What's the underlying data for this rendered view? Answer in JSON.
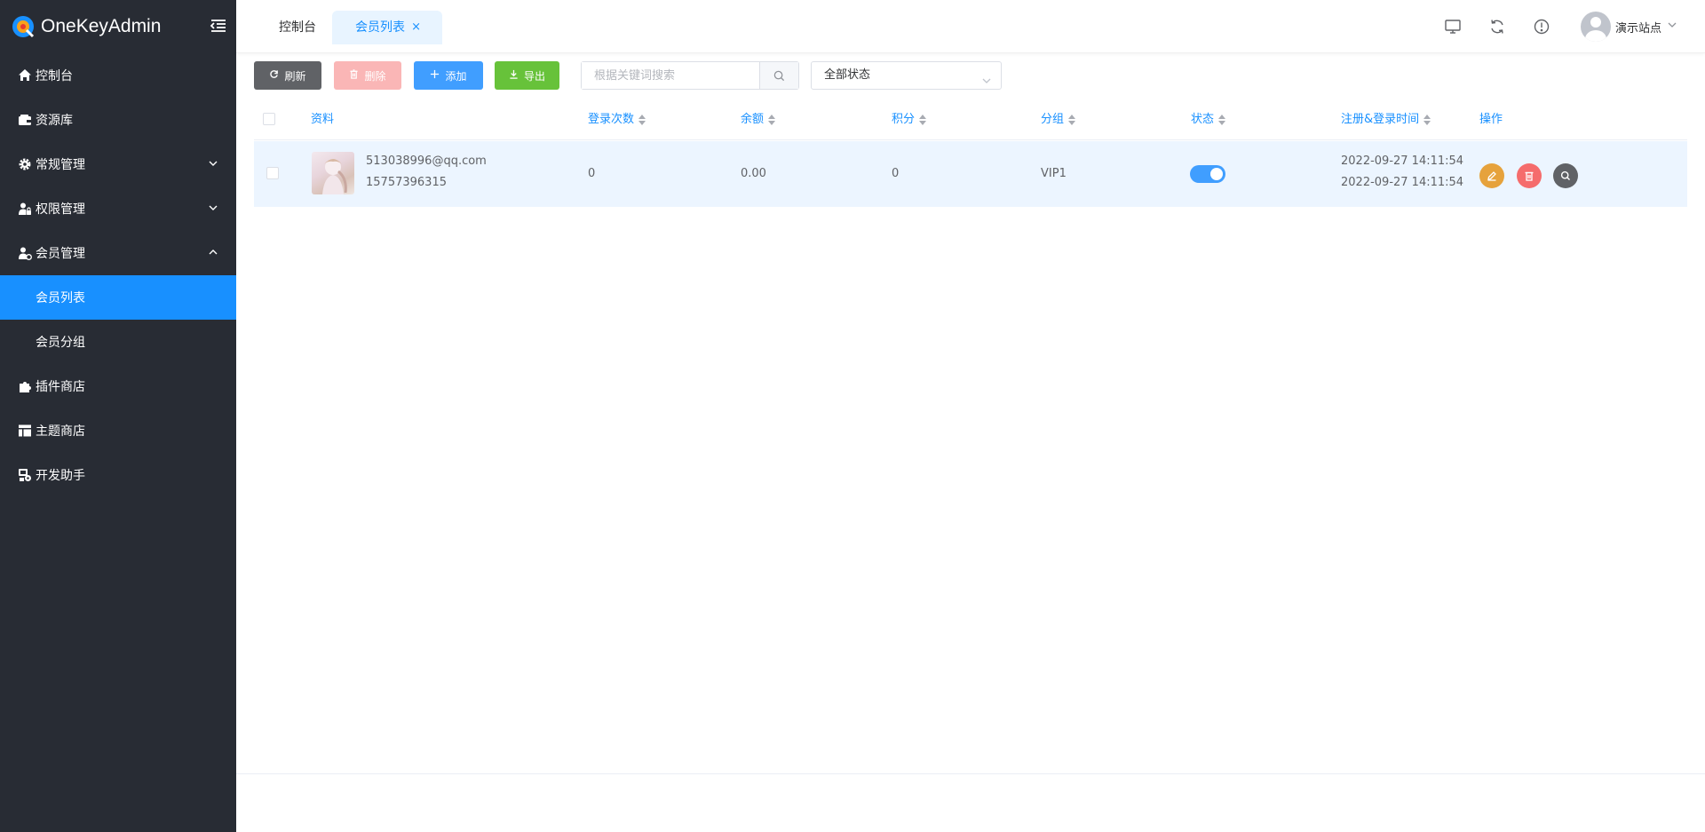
{
  "app": {
    "title": "OneKeyAdmin",
    "accent_color": "#1890ff",
    "sidebar_bg": "#282c34"
  },
  "sidebar": {
    "items": [
      {
        "label": "控制台",
        "icon": "home-icon"
      },
      {
        "label": "资源库",
        "icon": "wallet-icon"
      },
      {
        "label": "常规管理",
        "icon": "gear-icon",
        "expandable": true
      },
      {
        "label": "权限管理",
        "icon": "user-lock-icon",
        "expandable": true
      },
      {
        "label": "会员管理",
        "icon": "user-group-icon",
        "expandable": true,
        "expanded": true
      },
      {
        "label": "插件商店",
        "icon": "puzzle-icon"
      },
      {
        "label": "主题商店",
        "icon": "layout-icon"
      },
      {
        "label": "开发助手",
        "icon": "dev-tools-icon"
      }
    ],
    "submenu": [
      {
        "label": "会员列表",
        "active": true
      },
      {
        "label": "会员分组",
        "active": false
      }
    ]
  },
  "tabs": {
    "home": "控制台",
    "active": "会员列表",
    "close_glyph": "×"
  },
  "header": {
    "site_name": "演示站点"
  },
  "toolbar": {
    "refresh_label": "刷新",
    "delete_label": "删除",
    "add_label": "添加",
    "export_label": "导出",
    "search_placeholder": "根据关键词搜索",
    "status_filter": "全部状态"
  },
  "table": {
    "columns": {
      "profile": "资料",
      "login_count": "登录次数",
      "balance": "余额",
      "points": "积分",
      "group": "分组",
      "status": "状态",
      "time": "注册&登录时间",
      "actions": "操作"
    },
    "rows": [
      {
        "email": "513038996@qq.com",
        "phone": "15757396315",
        "login_count": "0",
        "balance": "0.00",
        "points": "0",
        "group": "VIP1",
        "status_on": true,
        "register_time": "2022-09-27 14:11:54",
        "login_time": "2022-09-27 14:11:54"
      }
    ]
  },
  "colors": {
    "edit": "#e6a23c",
    "delete": "#f56c6c",
    "view": "#606266",
    "switch_on": "#409eff"
  }
}
